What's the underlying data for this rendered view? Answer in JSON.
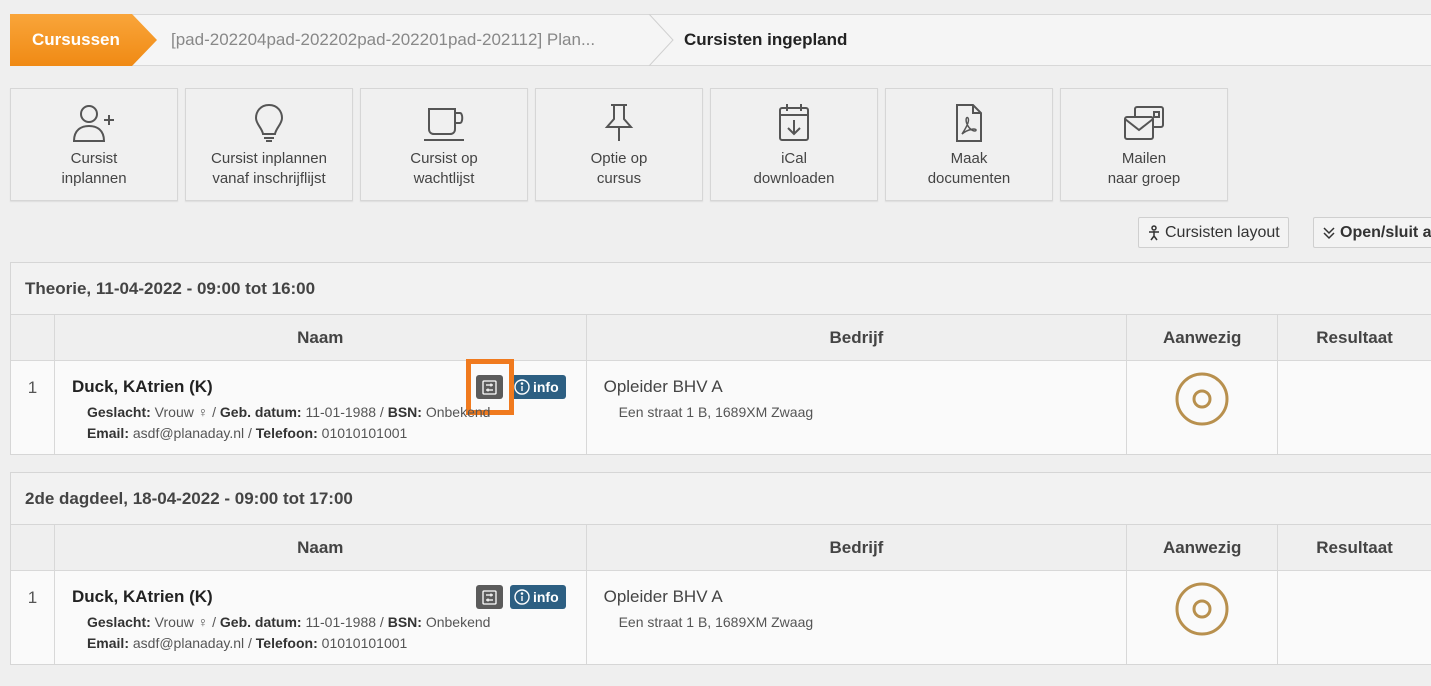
{
  "breadcrumb": {
    "home": "Cursussen",
    "course": "[pad-202204pad-202202pad-202201pad-202112] Plan...",
    "current": "Cursisten ingepland"
  },
  "toolbar": [
    {
      "label": "Cursist\ninplannen",
      "icon": "user-plus-icon"
    },
    {
      "label": "Cursist inplannen\nvanaf inschrijflijst",
      "icon": "lightbulb-icon"
    },
    {
      "label": "Cursist op\nwachtlijst",
      "icon": "coffee-cup-icon"
    },
    {
      "label": "Optie op\ncursus",
      "icon": "pushpin-icon"
    },
    {
      "label": "iCal\ndownloaden",
      "icon": "calendar-download-icon"
    },
    {
      "label": "Maak\ndocumenten",
      "icon": "pdf-document-icon"
    },
    {
      "label": "Mailen\nnaar groep",
      "icon": "group-mail-icon"
    }
  ],
  "actions": {
    "layout": "Cursisten layout",
    "toggle": "Open/sluit a"
  },
  "columns": {
    "naam": "Naam",
    "bedrijf": "Bedrijf",
    "aanwezig": "Aanwezig",
    "resultaat": "Resultaat"
  },
  "sessions": [
    {
      "title": "Theorie, 11-04-2022 - 09:00 tot 16:00",
      "rows": [
        {
          "num": "1",
          "name": "Duck, KAtrien (K)",
          "geslacht_label": "Geslacht:",
          "geslacht": "Vrouw",
          "gebdatum_label": "Geb. datum:",
          "gebdatum": "11-01-1988",
          "bsn_label": "BSN:",
          "bsn": "Onbekend",
          "email_label": "Email:",
          "email": "asdf@planaday.nl",
          "telefoon_label": "Telefoon:",
          "telefoon": "01010101001",
          "info": "info",
          "bedrijf": "Opleider BHV A",
          "adres": "Een straat 1 B, 1689XM Zwaag"
        }
      ]
    },
    {
      "title": "2de dagdeel, 18-04-2022 - 09:00 tot 17:00",
      "rows": [
        {
          "num": "1",
          "name": "Duck, KAtrien (K)",
          "geslacht_label": "Geslacht:",
          "geslacht": "Vrouw",
          "gebdatum_label": "Geb. datum:",
          "gebdatum": "11-01-1988",
          "bsn_label": "BSN:",
          "bsn": "Onbekend",
          "email_label": "Email:",
          "email": "asdf@planaday.nl",
          "telefoon_label": "Telefoon:",
          "telefoon": "01010101001",
          "info": "info",
          "bedrijf": "Opleider BHV A",
          "adres": "Een straat 1 B, 1689XM Zwaag"
        }
      ]
    }
  ],
  "colors": {
    "accent": "#f08a14",
    "highlight": "#f07a1e",
    "info": "#2d5f82",
    "attendance": "#b8904e"
  }
}
